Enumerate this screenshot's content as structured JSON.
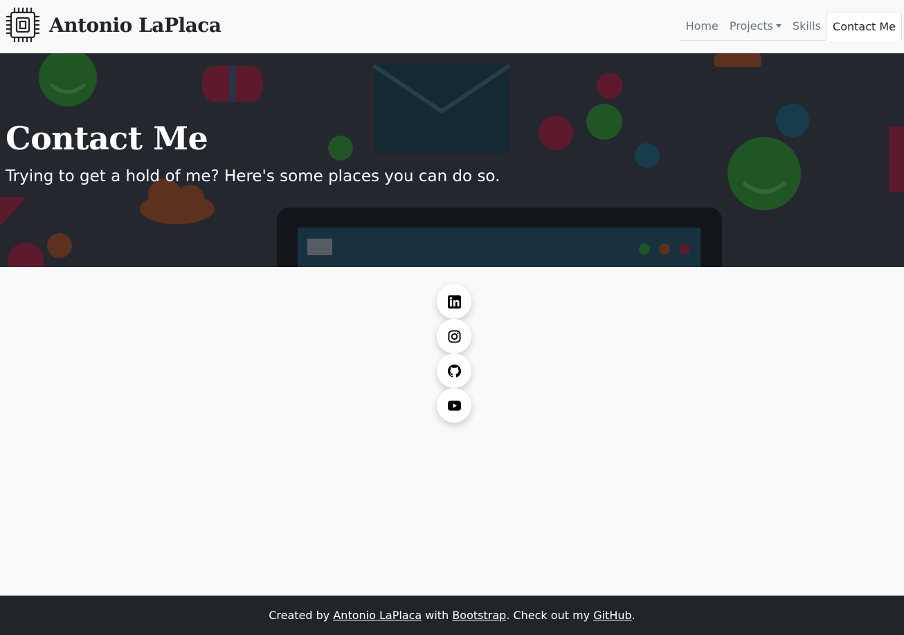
{
  "brand": {
    "name": "Antonio LaPlaca",
    "logo_icon": "chip-icon"
  },
  "nav": {
    "items": [
      {
        "label": "Home",
        "active": false
      },
      {
        "label": "Projects",
        "active": false,
        "dropdown": true
      },
      {
        "label": "Skills",
        "active": false
      },
      {
        "label": "Contact Me",
        "active": true
      }
    ]
  },
  "hero": {
    "title": "Contact Me",
    "subtitle": "Trying to get a hold of me? Here's some places you can do so."
  },
  "social": [
    {
      "icon": "linkedin-icon"
    },
    {
      "icon": "instagram-icon"
    },
    {
      "icon": "github-icon"
    },
    {
      "icon": "youtube-icon"
    }
  ],
  "footer": {
    "prefix": "Created by ",
    "author_link": "Antonio LaPlaca",
    "middle": " with ",
    "bootstrap_link": "Bootstrap",
    "after": ". Check out my ",
    "github_link": "GitHub",
    "suffix": "."
  },
  "colors": {
    "navbar_bg": "#f8f9fa",
    "hero_overlay": "#24282e",
    "footer_bg": "#212529",
    "text_dark": "#212529",
    "nav_muted": "#6c757d"
  }
}
